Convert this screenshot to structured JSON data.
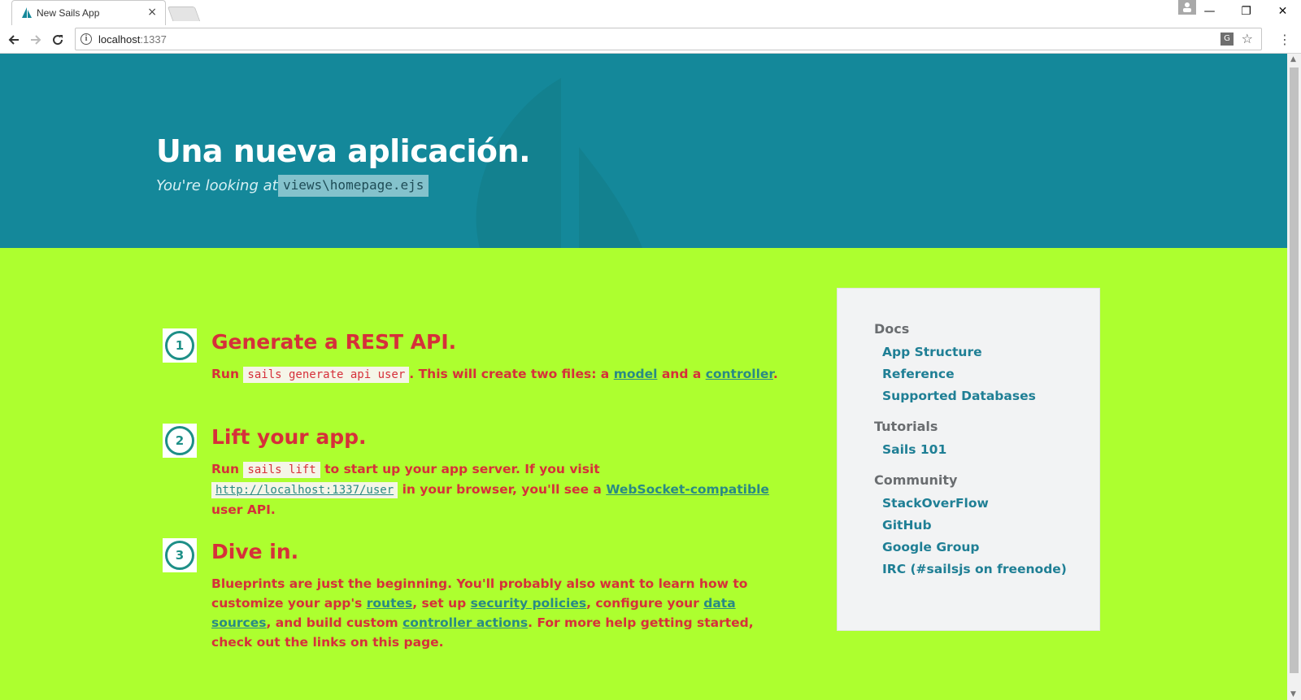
{
  "browser": {
    "tab_title": "New Sails App",
    "tab_close": "×",
    "url_host": "localhost",
    "url_port": ":1337",
    "window_controls": {
      "minimize": "—",
      "restore": "❐",
      "close": "✕"
    }
  },
  "hero": {
    "title": "Una nueva aplicación.",
    "looking_label": "You're looking at:",
    "path": "views\\homepage.ejs"
  },
  "steps": [
    {
      "number": "1",
      "title": "Generate a REST API.",
      "text_run": "Run",
      "code": "sails generate api user",
      "text_after_code": ". This will create two files: a",
      "link_model": "model",
      "text_and": "and a",
      "link_controller": "controller",
      "text_end": "."
    },
    {
      "number": "2",
      "title": "Lift your app.",
      "text_run": "Run",
      "code": "sails lift",
      "text_after_code": "to start up your app server. If you visit",
      "link_url": "http://localhost:1337/user",
      "text_browser": "in your browser, you'll see a",
      "link_websocket": "WebSocket-compatible",
      "text_end": "user API."
    },
    {
      "number": "3",
      "title": "Dive in.",
      "text_start": "Blueprints are just the beginning. You'll probably also want to learn how to customize your app's",
      "link_routes": "routes",
      "text_setup": ", set up",
      "link_policies": "security policies",
      "text_configure": ", configure your",
      "link_datasources": "data sources",
      "text_build": ", and build custom",
      "link_actions": "controller actions",
      "text_end": ". For more help getting started, check out the links on this page."
    }
  ],
  "sidebar": {
    "sections": [
      {
        "heading": "Docs",
        "links": [
          "App Structure",
          "Reference",
          "Supported Databases"
        ]
      },
      {
        "heading": "Tutorials",
        "links": [
          "Sails 101"
        ]
      },
      {
        "heading": "Community",
        "links": [
          "StackOverFlow",
          "GitHub",
          "Google Group",
          "IRC (#sailsjs on freenode)"
        ]
      }
    ]
  },
  "colors": {
    "hero_bg": "#14889a",
    "main_bg": "#adff2f",
    "heading_red": "#d6303a",
    "link_teal": "#2a8a84",
    "sidebar_link": "#1f7f95"
  }
}
